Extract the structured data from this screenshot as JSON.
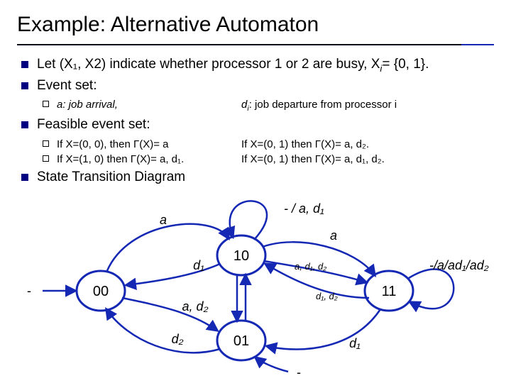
{
  "title": "Example: Alternative Automaton",
  "bullets": {
    "b1": "Let (X₁, X2) indicate whether processor 1 or 2 are busy, X",
    "b1_tail": "= {0, 1}.",
    "b1_sub": "i",
    "b2": "Event set:",
    "b2s1_l": "a: job arrival,",
    "b2s1_r": "d",
    "b2s1_r2": ": job departure from processor i",
    "b2s1_ri": "i",
    "b3": "Feasible event set:",
    "b3s1_l": "If X=(0, 0), then Γ(X)= a",
    "b3s1_r": "If X=(0, 1) then Γ(X)= a, d₂.",
    "b3s2_l": "If X=(1, 0) then Γ(X)= a, d₁.",
    "b3s2_r": "If X=(0, 1) then Γ(X)= a, d₁, d₂.",
    "b4": "State Transition Diagram"
  },
  "states": {
    "s00": "00",
    "s10": "10",
    "s01": "01",
    "s11": "11",
    "dashL": "-",
    "dashB": "-"
  },
  "edges": {
    "self10": "- / a, d₁",
    "self11": "-/a/ad₁/ad₂",
    "a_00_10": "a",
    "a_10_11": "a",
    "d1_10_00": "d₁",
    "ad2_00_01": "a, d₂",
    "d2_01_00": "d₂",
    "ad1d2_10_11": "a, d₁, d₂",
    "d1d2_11_10": "d₁, d₂",
    "d1_11_01": "d₁"
  },
  "chart_data": {
    "type": "diagram",
    "kind": "state-transition",
    "states": [
      "00",
      "10",
      "01",
      "11"
    ],
    "edges": [
      {
        "from": "00",
        "to": "10",
        "label": "a"
      },
      {
        "from": "10",
        "to": "00",
        "label": "d1"
      },
      {
        "from": "10",
        "to": "10",
        "label": "- / a, d1"
      },
      {
        "from": "10",
        "to": "11",
        "label": "a"
      },
      {
        "from": "10",
        "to": "11",
        "label": "a, d1, d2"
      },
      {
        "from": "11",
        "to": "10",
        "label": "d1, d2"
      },
      {
        "from": "11",
        "to": "11",
        "label": "-/a/ad1/ad2"
      },
      {
        "from": "00",
        "to": "01",
        "label": "a, d2"
      },
      {
        "from": "01",
        "to": "00",
        "label": "d2"
      },
      {
        "from": "11",
        "to": "01",
        "label": "d1"
      }
    ]
  }
}
